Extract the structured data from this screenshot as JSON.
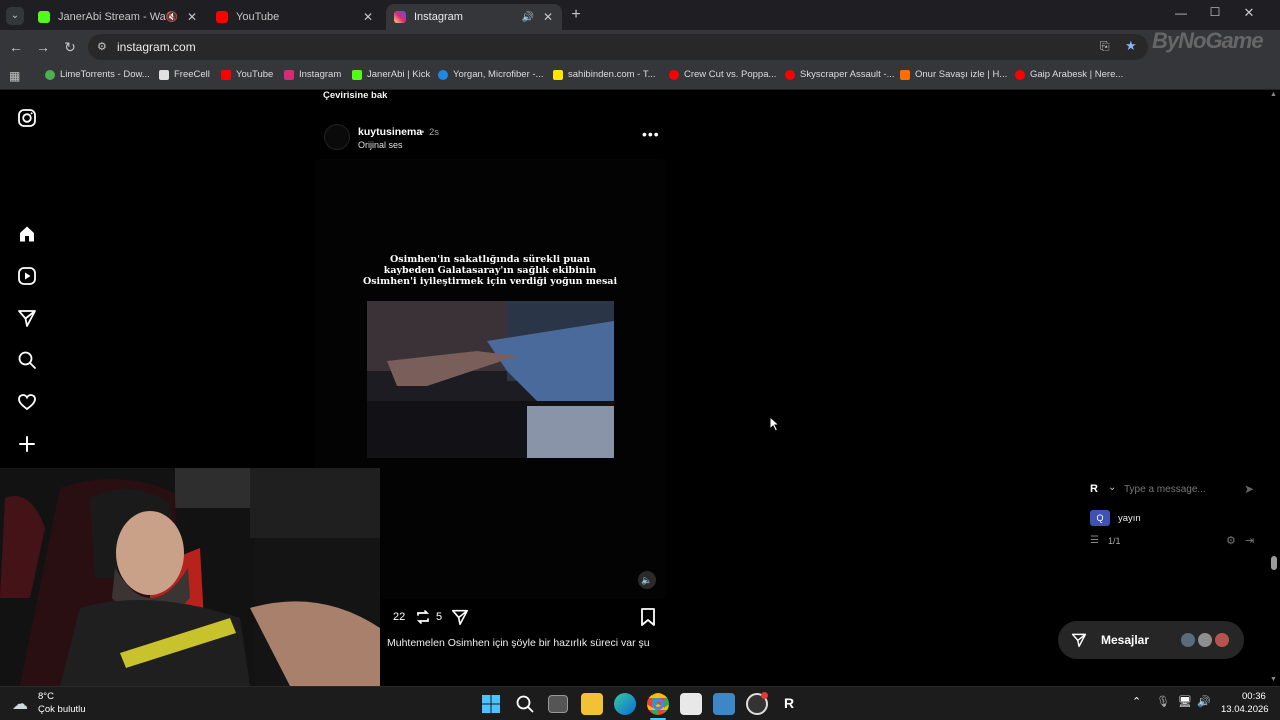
{
  "browser": {
    "tabs": [
      {
        "title": "JanerAbi Stream - Watch Live",
        "favicon_color": "#53fc18",
        "active": false
      },
      {
        "title": "YouTube",
        "favicon_color": "#ff0000",
        "active": false
      },
      {
        "title": "Instagram",
        "favicon_color": "#d62976",
        "active": true
      }
    ],
    "new_tab_label": "+",
    "url": "instagram.com",
    "bookmarks": [
      {
        "label": "LimeTorrents - Dow...",
        "color": "#4caf50"
      },
      {
        "label": "FreeCell",
        "color": "#e0e0e0"
      },
      {
        "label": "YouTube",
        "color": "#ff0000"
      },
      {
        "label": "Instagram",
        "color": "#d62976"
      },
      {
        "label": "JanerAbi | Kick",
        "color": "#53fc18"
      },
      {
        "label": "Yorgan, Microfiber -...",
        "color": "#1e88e5"
      },
      {
        "label": "sahibinden.com - T...",
        "color": "#ffe600"
      },
      {
        "label": "Crew Cut vs. Poppa...",
        "color": "#ff0000"
      },
      {
        "label": "Skyscraper Assault -...",
        "color": "#ff0000"
      },
      {
        "label": "Onur Savaşı izle | H...",
        "color": "#ff6f00"
      },
      {
        "label": "Gaip Arabesk | Nere...",
        "color": "#ff0000"
      }
    ],
    "watermark": "ByNoGame"
  },
  "post": {
    "translate_link": "Çevirisine bak",
    "username": "kuytusinema",
    "time": "2s",
    "audio": "Orijinal ses",
    "reel_caption": [
      "Osimhen'in sakatlığında sürekli puan",
      "kaybeden Galatasaray'ın sağlık ekibinin",
      "Osimhen'i iyileştirmek için verdiği yoğun mesai"
    ],
    "likes": "22",
    "reposts": "5",
    "description": "Muhtemelen Osimhen için şöyle bir hazırlık süreci var şu"
  },
  "chat_widget": {
    "input_placeholder": "Type a message...",
    "user_initial": "R",
    "entry_label": "yayın",
    "page_count": "1/1"
  },
  "messages_button": {
    "label": "Mesajlar"
  },
  "taskbar": {
    "weather_temp": "8°C",
    "weather_desc": "Çok bulutlu",
    "time": "00:36",
    "date": "13.04.2026",
    "app_letter": "R"
  }
}
